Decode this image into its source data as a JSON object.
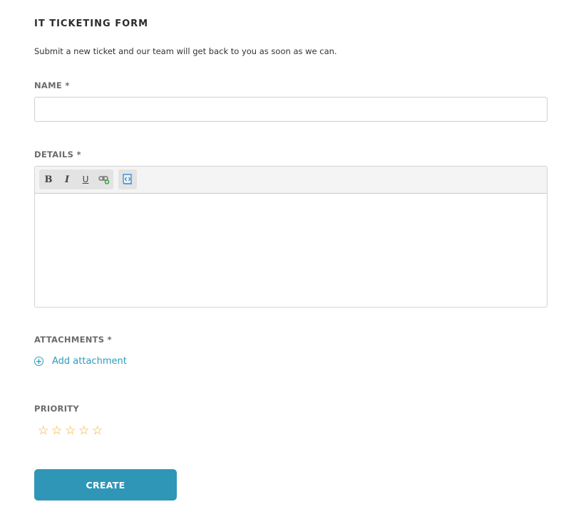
{
  "form": {
    "title": "IT TICKETING FORM",
    "subtitle": "Submit a new ticket and our team will get back to you as soon as we can."
  },
  "fields": {
    "name": {
      "label": "NAME *",
      "value": "",
      "placeholder": ""
    },
    "details": {
      "label": "DETAILS *",
      "value": "",
      "toolbar": {
        "bold": "B",
        "italic": "I",
        "underline": "U",
        "link_icon": "insert-link-icon",
        "source_icon": "html-source-icon"
      }
    },
    "attachments": {
      "label": "ATTACHMENTS *",
      "add_label": "Add attachment",
      "add_icon": "plus-circle-icon"
    },
    "priority": {
      "label": "PRIORITY",
      "rating": 0,
      "max": 5,
      "star_glyph": "☆"
    }
  },
  "actions": {
    "create_label": "CREATE"
  },
  "colors": {
    "accent": "#2c9cbd",
    "button": "#3096b8",
    "star": "#f5a623"
  }
}
